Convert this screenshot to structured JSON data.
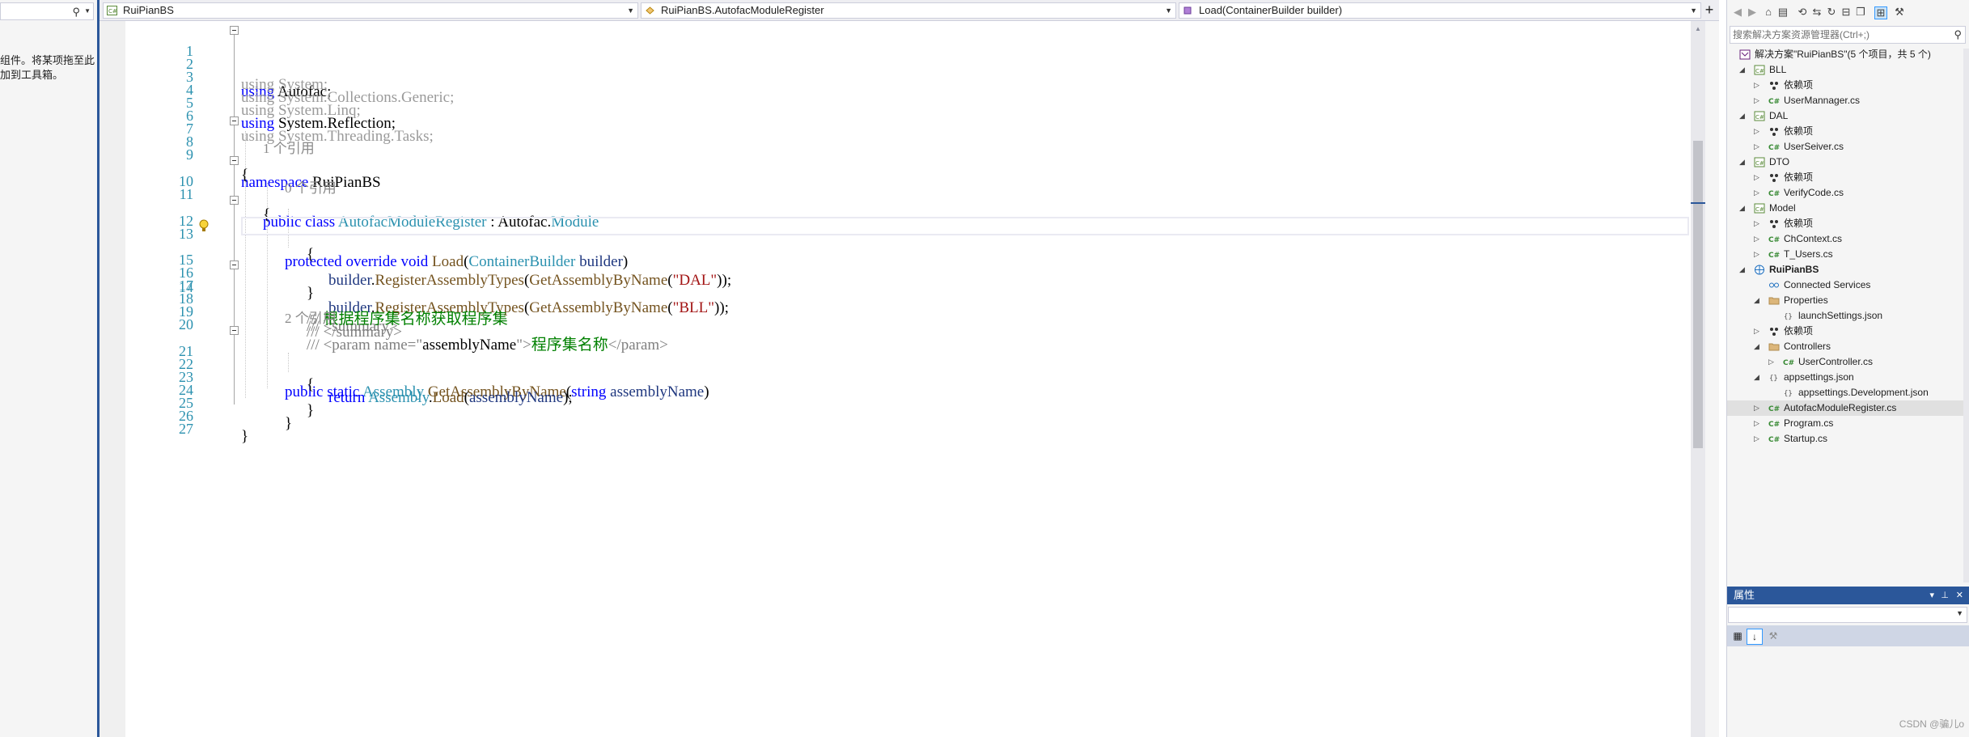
{
  "toolbox": {
    "search_placeholder": "",
    "hint_text": "组件。将某项拖至此\n加到工具箱。"
  },
  "navbar": {
    "project": "RuiPianBS",
    "type": "RuiPianBS.AutofacModuleRegister",
    "member": "Load(ContainerBuilder builder)"
  },
  "code": {
    "line_numbers": [
      "1",
      "2",
      "3",
      "4",
      "5",
      "6",
      "7",
      "8",
      "9",
      "10",
      "11",
      "12",
      "13",
      "14",
      "15",
      "16",
      "17",
      "18",
      "19",
      "20",
      "21",
      "22",
      "23",
      "24",
      "25",
      "26",
      "27"
    ],
    "codelens": {
      "class_refs": "1 个引用",
      "load_refs": "0 个引用",
      "method_refs": "2 个引用"
    },
    "lines": {
      "l1": [
        "using",
        " Autofac;"
      ],
      "l2": [
        "using",
        " System;"
      ],
      "l3": [
        "using",
        " System.Collections.Generic;"
      ],
      "l4": [
        "using",
        " System.Linq;"
      ],
      "l5": [
        "using",
        " System.Reflection;"
      ],
      "l6": [
        "using",
        " System.Threading.Tasks;"
      ],
      "l8": [
        "namespace",
        " RuiPianBS"
      ],
      "l9": "{",
      "l10": [
        "public",
        " ",
        "class",
        " ",
        "AutofacModuleRegister",
        " : Autofac.",
        "Module"
      ],
      "l11": "{",
      "l12": [
        "protected",
        " ",
        "override",
        " ",
        "void",
        " ",
        "Load",
        "(",
        "ContainerBuilder",
        " ",
        "builder",
        ")"
      ],
      "l13": "{",
      "l14": [
        "builder",
        ".",
        "RegisterAssemblyTypes",
        "(",
        "GetAssemblyByName",
        "(",
        "\"BLL\"",
        "));"
      ],
      "l15": [
        "builder",
        ".",
        "RegisterAssemblyTypes",
        "(",
        "GetAssemblyByName",
        "(",
        "\"DAL\"",
        "));"
      ],
      "l16": "}",
      "l17": [
        "/// <summary>"
      ],
      "l18": [
        "/// ",
        "根据程序集名称获取程序集"
      ],
      "l19": [
        "/// </summary>"
      ],
      "l20": [
        "/// <param name=\"",
        "assemblyName",
        "\">",
        "程序集名称",
        "</param>"
      ],
      "l21": [
        "public",
        " ",
        "static",
        " ",
        "Assembly",
        " ",
        "GetAssemblyByName",
        "(",
        "string",
        " ",
        "assemblyName",
        ")"
      ],
      "l22": "{",
      "l23": [
        "return",
        " ",
        "Assembly",
        ".",
        "Load",
        "(",
        "assemblyName",
        ");"
      ],
      "l24": "}",
      "l25": "}",
      "l26": "}"
    }
  },
  "solution_explorer": {
    "search_placeholder": "搜索解决方案资源管理器(Ctrl+;)",
    "solution_label": "解决方案\"RuiPianBS\"(5 个项目，共 5 个)",
    "items": [
      {
        "label": "BLL"
      },
      {
        "label": "依赖项"
      },
      {
        "label": "UserMannager.cs"
      },
      {
        "label": "DAL"
      },
      {
        "label": "依赖项"
      },
      {
        "label": "UserSeiver.cs"
      },
      {
        "label": "DTO"
      },
      {
        "label": "依赖项"
      },
      {
        "label": "VerifyCode.cs"
      },
      {
        "label": "Model"
      },
      {
        "label": "依赖项"
      },
      {
        "label": "ChContext.cs"
      },
      {
        "label": "T_Users.cs"
      },
      {
        "label": "RuiPianBS"
      },
      {
        "label": "Connected Services"
      },
      {
        "label": "Properties"
      },
      {
        "label": "launchSettings.json"
      },
      {
        "label": "依赖项"
      },
      {
        "label": "Controllers"
      },
      {
        "label": "UserController.cs"
      },
      {
        "label": "appsettings.json"
      },
      {
        "label": "appsettings.Development.json"
      },
      {
        "label": "AutofacModuleRegister.cs"
      },
      {
        "label": "Program.cs"
      },
      {
        "label": "Startup.cs"
      }
    ]
  },
  "properties": {
    "title": "属性"
  },
  "watermark": "CSDN @骗儿o",
  "colors": {
    "keyword": "#0000ff",
    "type": "#2b91af",
    "string": "#a31515",
    "comment": "#008000",
    "accent": "#2b579a"
  }
}
